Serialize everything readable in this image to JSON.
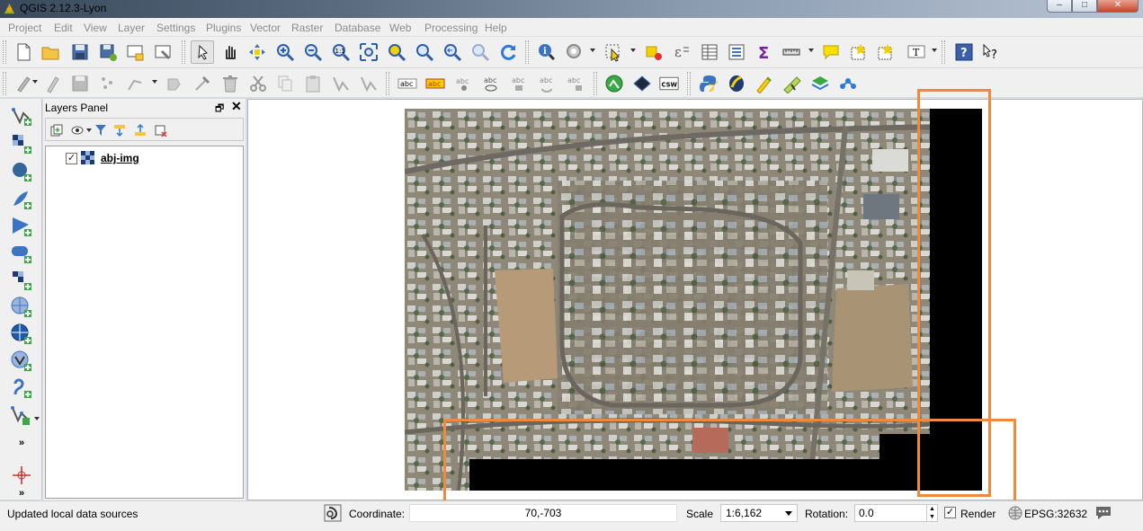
{
  "window": {
    "title": "QGIS 2.12.3-Lyon",
    "minimize_glyph": "–",
    "maximize_glyph": "□",
    "close_glyph": "✕"
  },
  "menu": {
    "items": [
      "Project",
      "Edit",
      "View",
      "Layer",
      "Settings",
      "Plugins",
      "Vector",
      "Raster",
      "Database",
      "Web",
      "Processing",
      "Help"
    ]
  },
  "toolbar1": {
    "icons": [
      "new-project-icon",
      "open-project-icon",
      "save-project-icon",
      "save-as-icon",
      "new-print-composer-icon",
      "composer-manager-icon",
      "pan-map-to-selection-icon",
      "pan-icon",
      "pan-to-selection-icon",
      "zoom-in-icon",
      "zoom-out-icon",
      "zoom-native-icon",
      "zoom-full-icon",
      "zoom-to-selection-icon",
      "zoom-to-layer-icon",
      "zoom-last-icon",
      "zoom-next-icon",
      "refresh-icon",
      "identify-icon",
      "action-icon",
      "select-icon",
      "deselect-icon",
      "open-field-calculator-icon",
      "attribute-table-icon",
      "statistics-icon",
      "sum-icon",
      "measure-icon",
      "map-tips-icon",
      "new-bookmark-icon",
      "show-bookmarks-icon",
      "text-annotation-icon",
      "help-icon",
      "whats-this-icon"
    ]
  },
  "toolbar2": {
    "text_icons": {
      "csw": "CSW",
      "abc": "abc"
    }
  },
  "layers_panel": {
    "title": "Layers Panel",
    "float_glyph": "🗗",
    "close_glyph": "✕",
    "layers": [
      {
        "name": "abj-img",
        "checked": true
      }
    ],
    "check_glyph": "✓"
  },
  "statusbar": {
    "message": "Updated local data sources",
    "coordinate_label": "Coordinate:",
    "coordinate_value": "70,-703",
    "scale_label": "Scale",
    "scale_value": "1:6,162",
    "rotation_label": "Rotation:",
    "rotation_value": "0.0",
    "render_label": "Render",
    "render_checked": true,
    "render_check_glyph": "✓",
    "crs": "EPSG:32632",
    "spin_up": "▲",
    "spin_down": "▼"
  },
  "colors": {
    "annotation_border": "#f08a3a",
    "nodata": "#000000",
    "panel_bg": "#f0f0f0",
    "menu_disabled": "#8c8c8c"
  }
}
